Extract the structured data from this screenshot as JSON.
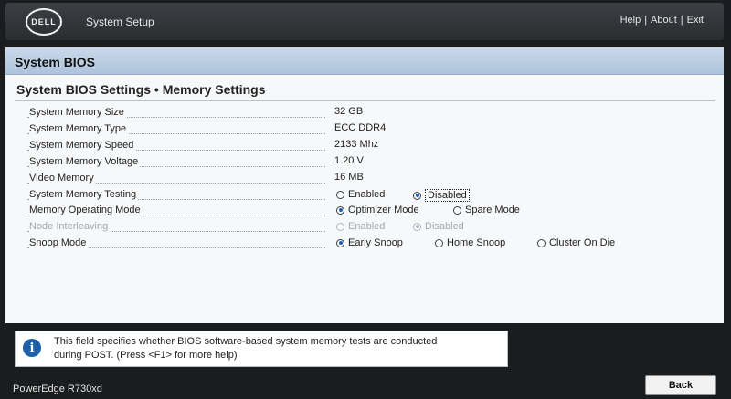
{
  "header": {
    "logo_text": "DELL",
    "app_title": "System Setup",
    "links": {
      "help": "Help",
      "about": "About",
      "exit": "Exit",
      "separator": "|"
    }
  },
  "panel": {
    "title": "System BIOS",
    "section_title": "System BIOS Settings • Memory Settings"
  },
  "settings": {
    "memory_size": {
      "label": "System Memory Size",
      "value": "32 GB"
    },
    "memory_type": {
      "label": "System Memory Type",
      "value": "ECC DDR4"
    },
    "memory_speed": {
      "label": "System Memory Speed",
      "value": "2133 Mhz"
    },
    "memory_voltage": {
      "label": "System Memory Voltage",
      "value": "1.20 V"
    },
    "video_memory": {
      "label": "Video Memory",
      "value": "16 MB"
    },
    "memory_testing": {
      "label": "System Memory Testing",
      "options": [
        "Enabled",
        "Disabled"
      ],
      "selected": "Disabled"
    },
    "operating_mode": {
      "label": "Memory Operating Mode",
      "options": [
        "Optimizer Mode",
        "Spare Mode"
      ],
      "selected": "Optimizer Mode"
    },
    "node_interleaving": {
      "label": "Node Interleaving",
      "options": [
        "Enabled",
        "Disabled"
      ],
      "selected": "Disabled",
      "state": "disabled"
    },
    "snoop_mode": {
      "label": "Snoop Mode",
      "options": [
        "Early Snoop",
        "Home Snoop",
        "Cluster On Die"
      ],
      "selected": "Early Snoop"
    }
  },
  "help": {
    "icon": "info-icon",
    "line1": "This field specifies whether BIOS software-based system memory tests are conducted",
    "line2": "during POST. (Press <F1> for more help)"
  },
  "footer": {
    "model": "PowerEdge R730xd",
    "back_label": "Back"
  },
  "colors": {
    "accent": "#1e5fa8",
    "header_bar": "#aec4dc",
    "background": "#1a1c1e"
  }
}
